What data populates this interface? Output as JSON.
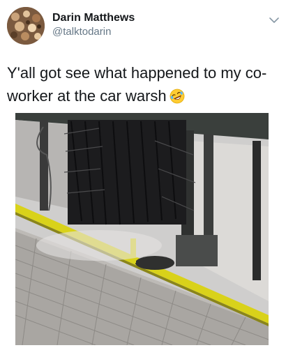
{
  "header": {
    "display_name": "Darin Matthews",
    "handle": "@talktodarin",
    "avatar_icon": "avatar-photo",
    "menu_icon": "chevron-down-icon"
  },
  "tweet": {
    "text": "Y'all got see what happened to my co-worker at the car warsh",
    "emoji": "rolling-on-floor-laughing-emoji"
  },
  "media": {
    "kind": "video-frame",
    "accent_colors": {
      "rail_yellow": "#d9d21a",
      "brush_dark": "#1c1c1e",
      "floor_grey": "#bdbab6"
    }
  }
}
